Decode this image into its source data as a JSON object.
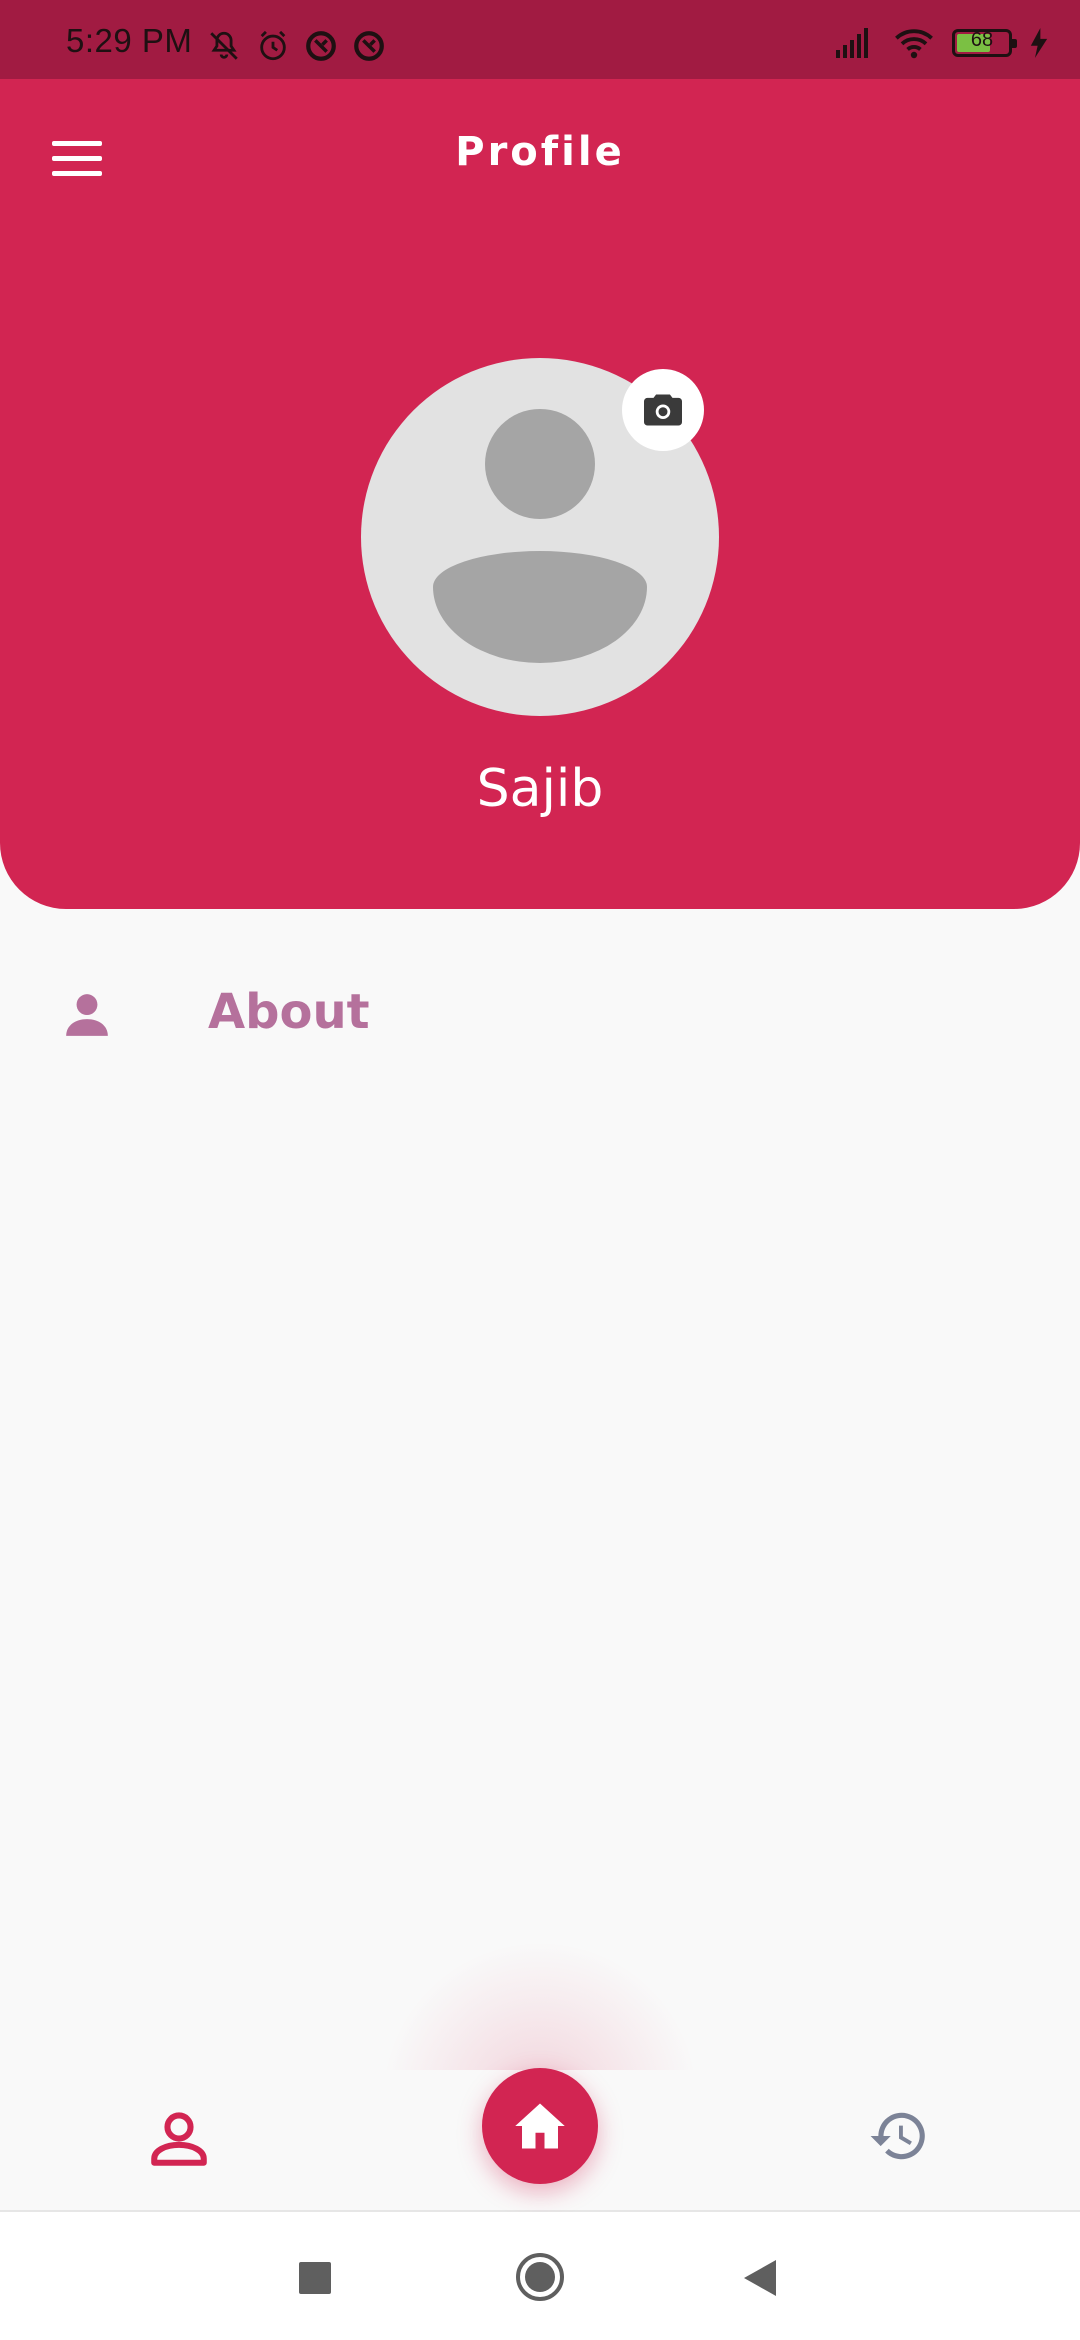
{
  "status_bar": {
    "time": "5:29 PM",
    "battery_level": "68",
    "battery_percent": 68,
    "left_icons": [
      "mute-icon",
      "alarm-icon",
      "data-saver-icon",
      "data-saver-icon"
    ],
    "right_icons": [
      "signal-icon",
      "wifi-icon",
      "battery-icon",
      "charging-icon"
    ]
  },
  "header": {
    "title": "Profile",
    "user_name": "Sajib",
    "menu_icon": "hamburger-menu-icon",
    "camera_icon": "camera-icon"
  },
  "sections": [
    {
      "icon": "person-icon",
      "label": "About"
    }
  ],
  "bottom_nav": {
    "items": [
      "profile-icon",
      "home-icon",
      "history-icon"
    ],
    "active": "profile"
  },
  "system_nav": [
    "recents-button",
    "home-button",
    "back-button"
  ],
  "colors": {
    "primary": "#d22552",
    "status_bar": "#a11b42",
    "about_text": "#b5719c",
    "background": "#f9f9f9"
  }
}
